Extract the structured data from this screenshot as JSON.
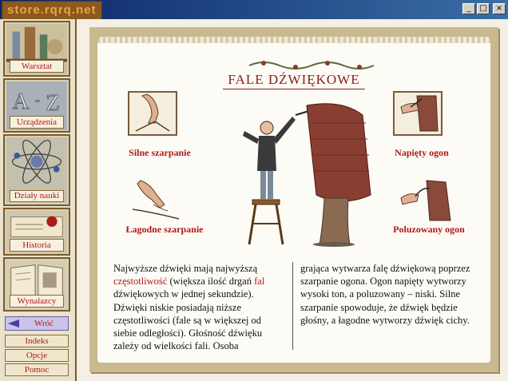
{
  "window": {
    "logo_text": "store.rqrq.net",
    "buttons": {
      "minimize": "_",
      "maximize": "□",
      "close": "×"
    }
  },
  "sidebar": {
    "items": [
      {
        "label": "Warsztat"
      },
      {
        "label": "Urządzenia"
      },
      {
        "label": "Działy nauki"
      },
      {
        "label": "Historia"
      },
      {
        "label": "Wynalazcy"
      }
    ],
    "back_label": "Wróć",
    "small_buttons": [
      "Indeks",
      "Opcje",
      "Pomoc"
    ]
  },
  "page": {
    "title": "FALE DŹWIĘKOWE",
    "captions": {
      "strong_pluck": "Silne szarpanie",
      "gentle_pluck": "Łagodne szarpanie",
      "taut_tail": "Napięty ogon",
      "loose_tail": "Poluzowany ogon"
    },
    "left_column": {
      "p1": "Najwyższe dźwięki mają najwyższą",
      "term1": "częstotliwość",
      "p2": " (większa ilość drgań ",
      "term2": "fal",
      "p3": " dźwiękowych w jednej sekundzie). Dźwięki niskie posiadają niższe częstotliwości (fale są w większej od siebie odległości). Głośność dźwięku zależy od wielkości fali. Osoba"
    },
    "right_column": {
      "text": "grająca wytwarza falę dźwiękową poprzez szarpanie ogona. Ogon napięty wytworzy wysoki ton, a poluzowany – niski. Silne szarpanie spowoduje, że dźwięk będzie głośny, a łagodne wytworzy dźwięk cichy."
    }
  },
  "colors": {
    "title_bar": "#0a246a",
    "accent_red": "#b01818",
    "parchment": "#c9b98f",
    "paper": "#fdfbf6"
  }
}
